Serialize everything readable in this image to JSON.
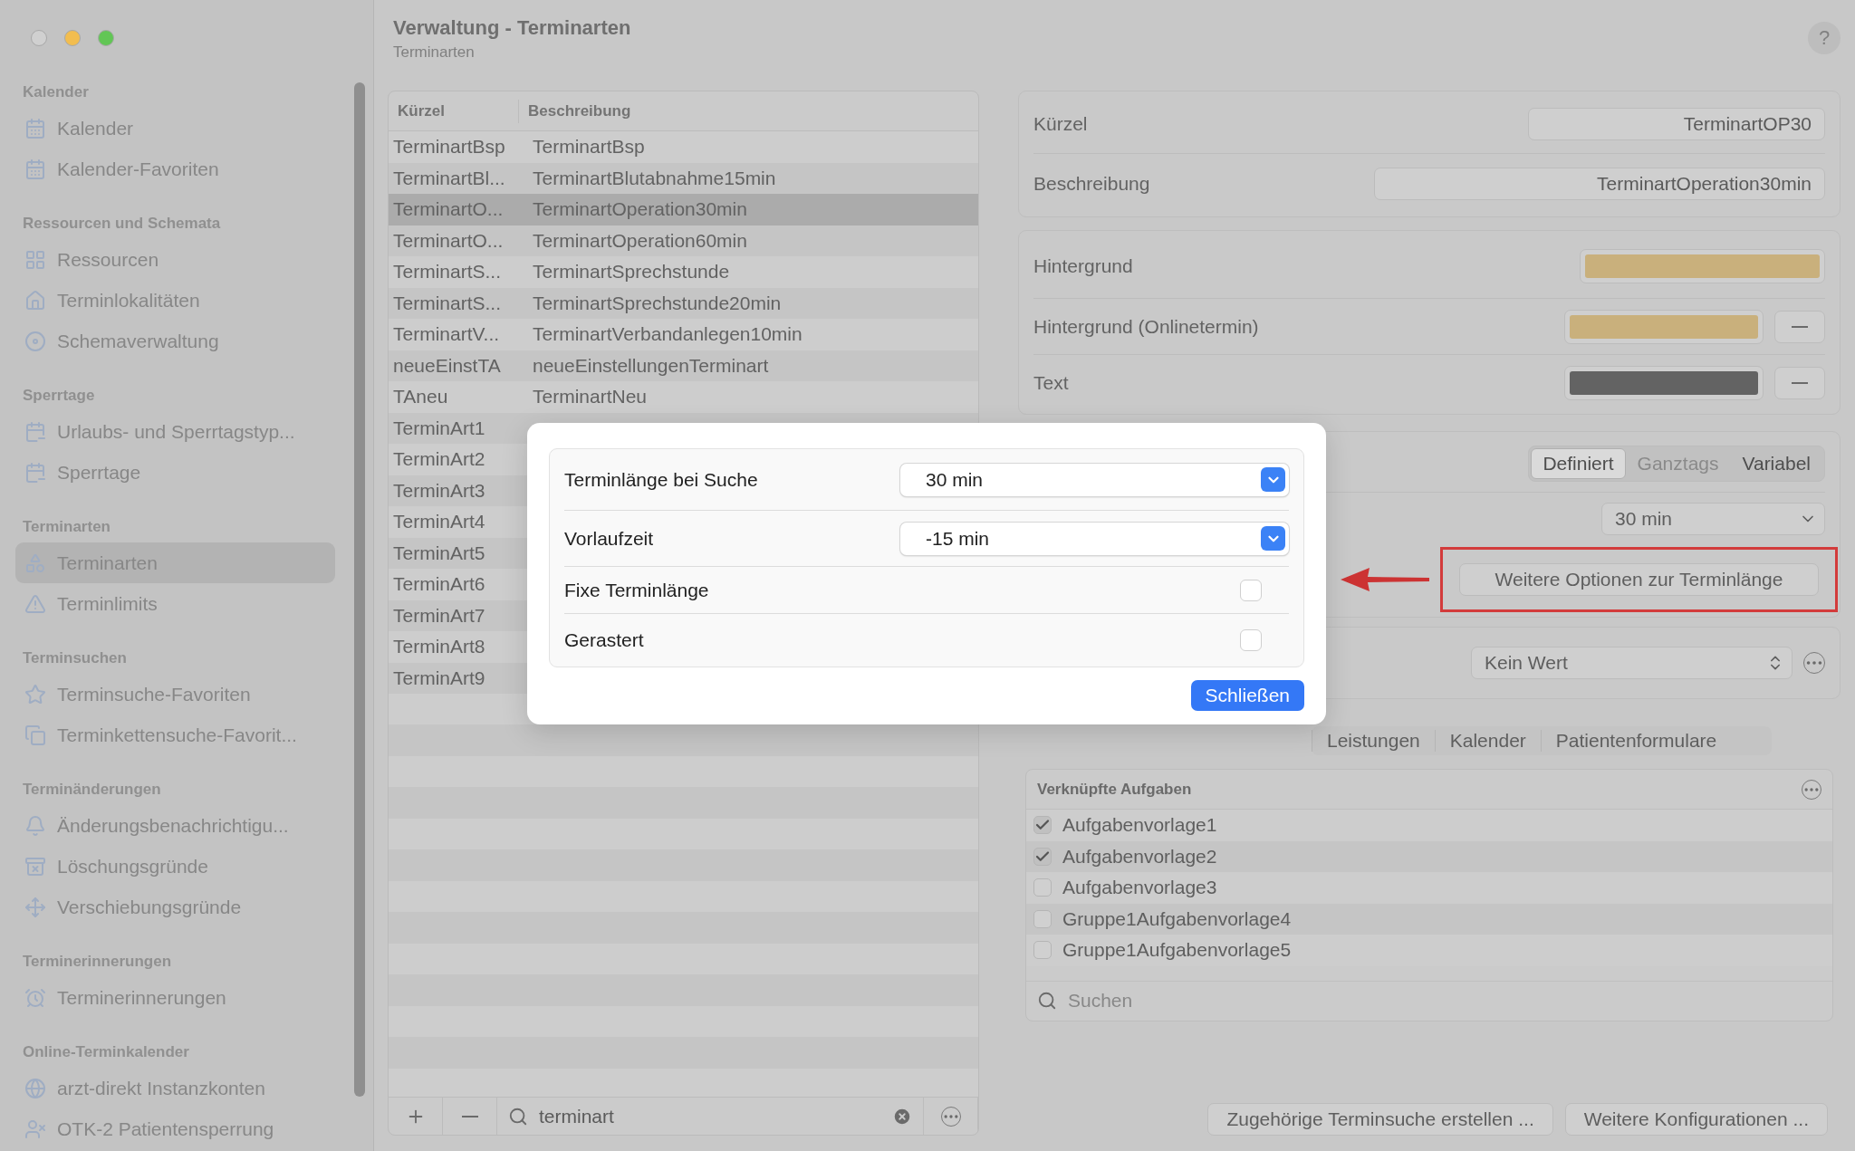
{
  "window": {
    "controls": [
      {
        "color": "#d0d0d0"
      },
      {
        "color": "#f2bd4f"
      },
      {
        "color": "#62c655"
      }
    ]
  },
  "sidebar": {
    "sections": [
      {
        "title": "Kalender",
        "items": [
          {
            "label": "Kalender",
            "selected": false
          },
          {
            "label": "Kalender-Favoriten",
            "selected": false
          }
        ]
      },
      {
        "title": "Ressourcen und Schemata",
        "items": [
          {
            "label": "Ressourcen",
            "selected": false
          },
          {
            "label": "Terminlokalitäten",
            "selected": false
          },
          {
            "label": "Schemaverwaltung",
            "selected": false
          }
        ]
      },
      {
        "title": "Sperrtage",
        "items": [
          {
            "label": "Urlaubs- und Sperrtagstyp...",
            "selected": false
          },
          {
            "label": "Sperrtage",
            "selected": false
          }
        ]
      },
      {
        "title": "Terminarten",
        "items": [
          {
            "label": "Terminarten",
            "selected": true
          },
          {
            "label": "Terminlimits",
            "selected": false
          }
        ]
      },
      {
        "title": "Terminsuchen",
        "items": [
          {
            "label": "Terminsuche-Favoriten",
            "selected": false
          },
          {
            "label": "Terminkettensuche-Favorit...",
            "selected": false
          }
        ]
      },
      {
        "title": "Terminänderungen",
        "items": [
          {
            "label": "Änderungsbenachrichtigu...",
            "selected": false
          },
          {
            "label": "Löschungsgründe",
            "selected": false
          },
          {
            "label": "Verschiebungsgründe",
            "selected": false
          }
        ]
      },
      {
        "title": "Terminerinnerungen",
        "items": [
          {
            "label": "Terminerinnerungen",
            "selected": false
          }
        ]
      },
      {
        "title": "Online-Terminkalender",
        "items": [
          {
            "label": "arzt-direkt Instanzkonten",
            "selected": false
          },
          {
            "label": "OTK-2 Patientensperrung",
            "selected": false
          }
        ]
      }
    ]
  },
  "header": {
    "title": "Verwaltung - Terminarten",
    "subtitle": "Terminarten",
    "help": "?"
  },
  "list": {
    "columns": [
      "Kürzel",
      "Beschreibung"
    ],
    "rows": [
      {
        "cells": [
          "TerminartBsp",
          "TerminartBsp"
        ],
        "selected": false
      },
      {
        "cells": [
          "TerminartBl...",
          "TerminartBlutabnahme15min"
        ],
        "selected": false
      },
      {
        "cells": [
          "TerminartO...",
          "TerminartOperation30min"
        ],
        "selected": true
      },
      {
        "cells": [
          "TerminartO...",
          "TerminartOperation60min"
        ],
        "selected": false
      },
      {
        "cells": [
          "TerminartS...",
          "TerminartSprechstunde"
        ],
        "selected": false
      },
      {
        "cells": [
          "TerminartS...",
          "TerminartSprechstunde20min"
        ],
        "selected": false
      },
      {
        "cells": [
          "TerminartV...",
          "TerminartVerbandanlegen10min"
        ],
        "selected": false
      },
      {
        "cells": [
          "neueEinstTA",
          "neueEinstellungenTerminart"
        ],
        "selected": false
      },
      {
        "cells": [
          "TAneu",
          "TerminartNeu"
        ],
        "selected": false
      },
      {
        "cells": [
          "TerminArt1"
        ],
        "selected": false
      },
      {
        "cells": [
          "TerminArt2"
        ],
        "selected": false
      },
      {
        "cells": [
          "TerminArt3"
        ],
        "selected": false
      },
      {
        "cells": [
          "TerminArt4"
        ],
        "selected": false
      },
      {
        "cells": [
          "TerminArt5"
        ],
        "selected": false
      },
      {
        "cells": [
          "TerminArt6"
        ],
        "selected": false
      },
      {
        "cells": [
          "TerminArt7"
        ],
        "selected": false
      },
      {
        "cells": [
          "TerminArt8"
        ],
        "selected": false
      },
      {
        "cells": [
          "TerminArt9"
        ],
        "selected": false
      }
    ],
    "search": {
      "value": "terminart"
    }
  },
  "detail": {
    "fields": [
      {
        "label": "Kürzel",
        "value": "TerminartOP30"
      },
      {
        "label": "Beschreibung",
        "value": "TerminartOperation30min"
      }
    ],
    "colors": [
      {
        "label": "Hintergrund",
        "color": "#c9b07c",
        "clearable": false
      },
      {
        "label": "Hintergrund (Onlinetermin)",
        "color": "#c9b07c",
        "clearable": true
      },
      {
        "label": "Text",
        "color": "#636363",
        "clearable": true
      }
    ],
    "segments": [
      {
        "label": "Definiert",
        "selected": true,
        "disabled": false
      },
      {
        "label": "Ganztags",
        "selected": false,
        "disabled": true
      },
      {
        "label": "Variabel",
        "selected": false,
        "disabled": false
      }
    ],
    "duration": "30 min",
    "options_button": {
      "label": "Weitere Optionen zur Terminlänge",
      "highlighted": true
    },
    "popup": "Kein Wert",
    "tabs": [
      {
        "label": "Leistungen",
        "selected": false
      },
      {
        "label": "Kalender",
        "selected": false
      },
      {
        "label": "Patientenformulare",
        "selected": false
      }
    ],
    "tasks": {
      "title": "Verknüpfte Aufgaben",
      "items": [
        {
          "label": "Aufgabenvorlage1",
          "checked": true
        },
        {
          "label": "Aufgabenvorlage2",
          "checked": true
        },
        {
          "label": "Aufgabenvorlage3",
          "checked": false
        },
        {
          "label": "Gruppe1Aufgabenvorlage4",
          "checked": false
        },
        {
          "label": "Gruppe1Aufgabenvorlage5",
          "checked": false
        }
      ],
      "placeholder": "Suchen"
    },
    "buttons": [
      "Zugehörige Terminsuche erstellen ...",
      "Weitere Konfigurationen ..."
    ]
  },
  "dialog": {
    "rows": [
      {
        "kind": "select",
        "label": "Terminlänge bei Suche",
        "value": "30 min"
      },
      {
        "kind": "select",
        "label": "Vorlaufzeit",
        "value": "-15 min"
      },
      {
        "kind": "checkbox",
        "label": "Fixe Terminlänge",
        "checked": false
      },
      {
        "kind": "checkbox",
        "label": "Gerastert",
        "checked": false
      }
    ],
    "button": "Schließen"
  }
}
